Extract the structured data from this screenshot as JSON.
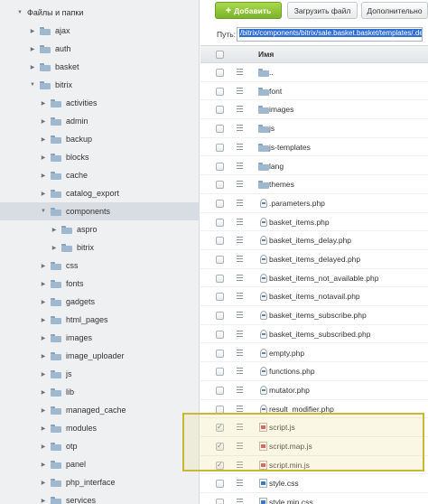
{
  "tree": {
    "root_label": "Файлы и папки",
    "items": [
      {
        "label": "ajax",
        "expanded": false
      },
      {
        "label": "auth",
        "expanded": false
      },
      {
        "label": "basket",
        "expanded": false
      },
      {
        "label": "bitrix",
        "expanded": true
      },
      {
        "label": "activities",
        "expanded": false
      },
      {
        "label": "admin",
        "expanded": false
      },
      {
        "label": "backup",
        "expanded": false
      },
      {
        "label": "blocks",
        "expanded": false
      },
      {
        "label": "cache",
        "expanded": false
      },
      {
        "label": "catalog_export",
        "expanded": false
      },
      {
        "label": "components",
        "expanded": true,
        "selected": true
      },
      {
        "label": "aspro",
        "expanded": false
      },
      {
        "label": "bitrix",
        "expanded": false
      },
      {
        "label": "css",
        "expanded": false
      },
      {
        "label": "fonts",
        "expanded": false
      },
      {
        "label": "gadgets",
        "expanded": false
      },
      {
        "label": "html_pages",
        "expanded": false
      },
      {
        "label": "images",
        "expanded": false
      },
      {
        "label": "image_uploader",
        "expanded": false
      },
      {
        "label": "js",
        "expanded": false
      },
      {
        "label": "lib",
        "expanded": false
      },
      {
        "label": "managed_cache",
        "expanded": false
      },
      {
        "label": "modules",
        "expanded": false
      },
      {
        "label": "otp",
        "expanded": false
      },
      {
        "label": "panel",
        "expanded": false
      },
      {
        "label": "php_interface",
        "expanded": false
      },
      {
        "label": "services",
        "expanded": false
      }
    ]
  },
  "toolbar": {
    "add_label": "Добавить",
    "upload_label": "Загрузить файл",
    "more_label": "Дополнительно"
  },
  "path": {
    "label": "Путь:",
    "value": "/bitrix/components/bitrix/sale.basket.basket/templates/.default"
  },
  "list": {
    "header_name": "Имя",
    "files": [
      {
        "name": "..",
        "type": "folder",
        "checked": false
      },
      {
        "name": "font",
        "type": "folder",
        "checked": false
      },
      {
        "name": "images",
        "type": "folder",
        "checked": false
      },
      {
        "name": "js",
        "type": "folder",
        "checked": false
      },
      {
        "name": "js-templates",
        "type": "folder",
        "checked": false
      },
      {
        "name": "lang",
        "type": "folder",
        "checked": false
      },
      {
        "name": "themes",
        "type": "folder",
        "checked": false
      },
      {
        "name": ".parameters.php",
        "type": "php",
        "checked": false
      },
      {
        "name": "basket_items.php",
        "type": "php",
        "checked": false
      },
      {
        "name": "basket_items_delay.php",
        "type": "php",
        "checked": false
      },
      {
        "name": "basket_items_delayed.php",
        "type": "php",
        "checked": false
      },
      {
        "name": "basket_items_not_available.php",
        "type": "php",
        "checked": false
      },
      {
        "name": "basket_items_notavail.php",
        "type": "php",
        "checked": false
      },
      {
        "name": "basket_items_subscribe.php",
        "type": "php",
        "checked": false
      },
      {
        "name": "basket_items_subscribed.php",
        "type": "php",
        "checked": false
      },
      {
        "name": "empty.php",
        "type": "php",
        "checked": false
      },
      {
        "name": "functions.php",
        "type": "php",
        "checked": false
      },
      {
        "name": "mutator.php",
        "type": "php",
        "checked": false
      },
      {
        "name": "result_modifier.php",
        "type": "php",
        "checked": false
      },
      {
        "name": "script.js",
        "type": "js",
        "checked": true
      },
      {
        "name": "script.map.js",
        "type": "js",
        "checked": true
      },
      {
        "name": "script.min.js",
        "type": "js",
        "checked": true
      },
      {
        "name": "style.css",
        "type": "css",
        "checked": false
      },
      {
        "name": "style.min.css",
        "type": "css",
        "checked": false
      }
    ]
  },
  "colors": {
    "add_button": "#7bb42a",
    "highlight_border": "#c9b832",
    "path_selection": "#2f6fd6"
  }
}
